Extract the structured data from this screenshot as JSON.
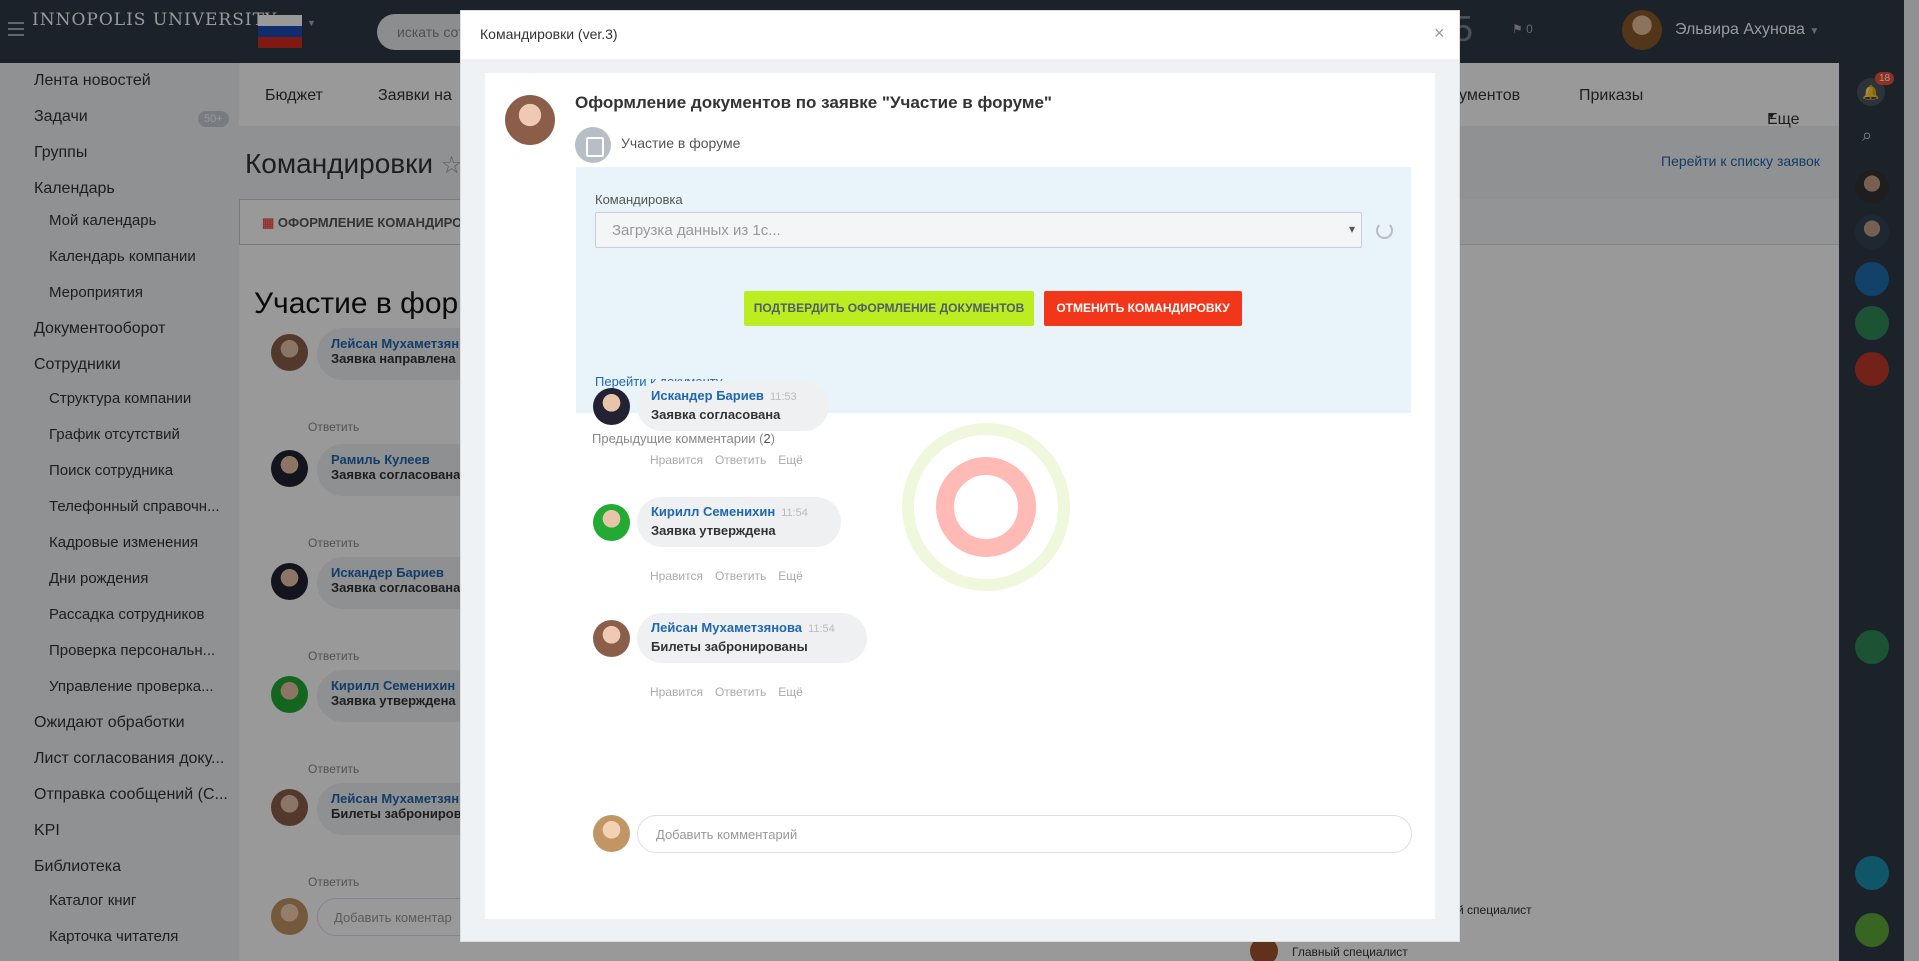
{
  "header": {
    "logo": "INNOPOLIS UNIVERSITY",
    "search_placeholder": "искать сотрудника",
    "count_digit": "5",
    "flag_count": "0",
    "user_name": "Эльвира Ахунова",
    "help": "?"
  },
  "left_menu": {
    "items": [
      "Лента новостей",
      "Задачи",
      "Группы",
      "Календарь",
      "Мой календарь",
      "Календарь компании",
      "Мероприятия",
      "Документооборот",
      "Сотрудники",
      "Структура компании",
      "График отсутствий",
      "Поиск сотрудника",
      "Телефонный справочн...",
      "Кадровые изменения",
      "Дни рождения",
      "Рассадка сотрудников",
      "Проверка персональн...",
      "Управление проверка...",
      "Ожидают обработки",
      "Лист согласования доку...",
      "Отправка сообщений (С...",
      "KPI",
      "Библиотека",
      "Каталог книг",
      "Карточка читателя"
    ],
    "tasks_badge": "50+"
  },
  "top_nav": {
    "items": [
      "Бюджет",
      "Заявки на",
      "ументов",
      "Приказы",
      "Еще"
    ]
  },
  "page": {
    "title": "Командировки",
    "tab_label": "ОФОРМЛЕНИЕ КОМАНДИРОВ",
    "go_to_list": "Перейти к списку заявок",
    "heading": "Участие в фор",
    "feed": [
      {
        "name": "Лейсан Мухаметзян",
        "text": "Заявка направлена",
        "reply": "Ответить"
      },
      {
        "name": "Рамиль Кулеев",
        "time": "11:5",
        "text": "Заявка согласована",
        "reply": "Ответить"
      },
      {
        "name": "Искандер Бариев",
        "time": "1",
        "text": "Заявка согласована",
        "reply": "Ответить"
      },
      {
        "name": "Кирилл Семенихин",
        "text": "Заявка утверждена",
        "reply": "Ответить"
      },
      {
        "name": "Лейсан Мухаметзян",
        "text": "Билеты забронирова",
        "reply": "Ответить"
      }
    ],
    "add_comment": "Добавить коментар",
    "right_entries": [
      "й специалист",
      "Главный специалист"
    ]
  },
  "right_sidebar": {
    "notif_count": "18"
  },
  "modal": {
    "title": "Командировки (ver.3)",
    "close": "×",
    "post_title": "Оформление документов по заявке \"Участие в форуме\"",
    "post_subtitle": "Участие в форуме",
    "field_label": "Командировка",
    "select_value": "Загрузка данных из 1с...",
    "confirm_button": "ПОДТВЕРДИТЬ ОФОРМЛЕНИЕ ДОКУМЕНТОВ",
    "cancel_button": "ОТМЕНИТЬ КОМАНДИРОВКУ",
    "doc_link": "Перейти к документу",
    "prev_comments_label": "Предыдущие комментарии",
    "prev_comments_count": "2",
    "comments": [
      {
        "name": "Искандер Бариев",
        "time": "11:53",
        "text": "Заявка согласована"
      },
      {
        "name": "Кирилл Семенихин",
        "time": "11:54",
        "text": "Заявка утверждена"
      },
      {
        "name": "Лейсан Мухаметзянова",
        "time": "11:54",
        "text": "Билеты забронированы"
      }
    ],
    "actions": {
      "like": "Нравится",
      "reply": "Ответить",
      "more": "Ещё"
    },
    "add_comment_placeholder": "Добавить комментарий"
  }
}
